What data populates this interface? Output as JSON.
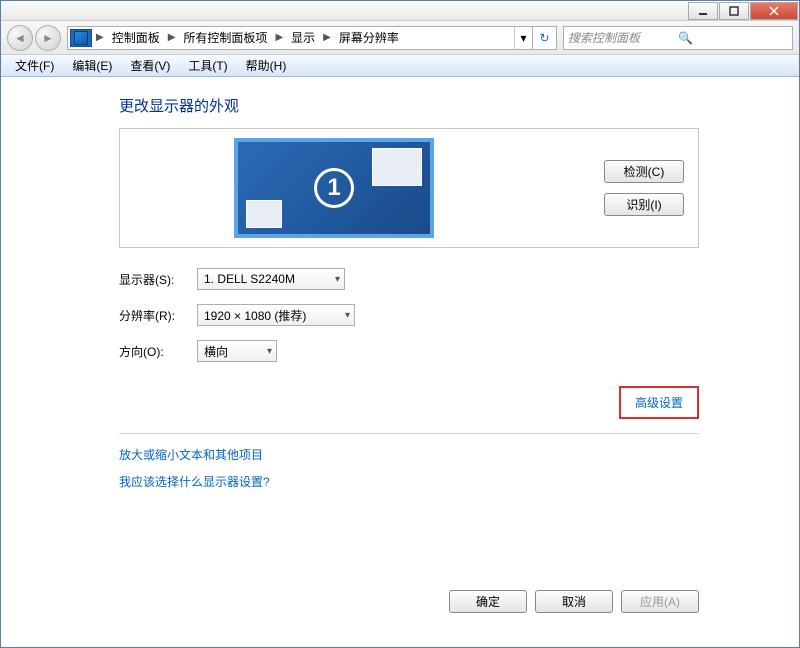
{
  "titlebar": {
    "minimize_tip": "最小化",
    "maximize_tip": "最大化",
    "close_tip": "关闭"
  },
  "breadcrumb": {
    "items": [
      "控制面板",
      "所有控制面板项",
      "显示",
      "屏幕分辨率"
    ]
  },
  "search": {
    "placeholder": "搜索控制面板"
  },
  "menu": {
    "file": "文件(F)",
    "edit": "编辑(E)",
    "view": "查看(V)",
    "tools": "工具(T)",
    "help": "帮助(H)"
  },
  "page": {
    "title": "更改显示器的外观",
    "monitor_number": "1",
    "detect_btn": "检测(C)",
    "identify_btn": "识别(I)",
    "form": {
      "display_label": "显示器(S):",
      "display_value": "1. DELL S2240M",
      "resolution_label": "分辨率(R):",
      "resolution_value": "1920 × 1080 (推荐)",
      "orientation_label": "方向(O):",
      "orientation_value": "横向"
    },
    "advanced_link": "高级设置",
    "help1": "放大或缩小文本和其他项目",
    "help2": "我应该选择什么显示器设置?",
    "ok_btn": "确定",
    "cancel_btn": "取消",
    "apply_btn": "应用(A)"
  }
}
